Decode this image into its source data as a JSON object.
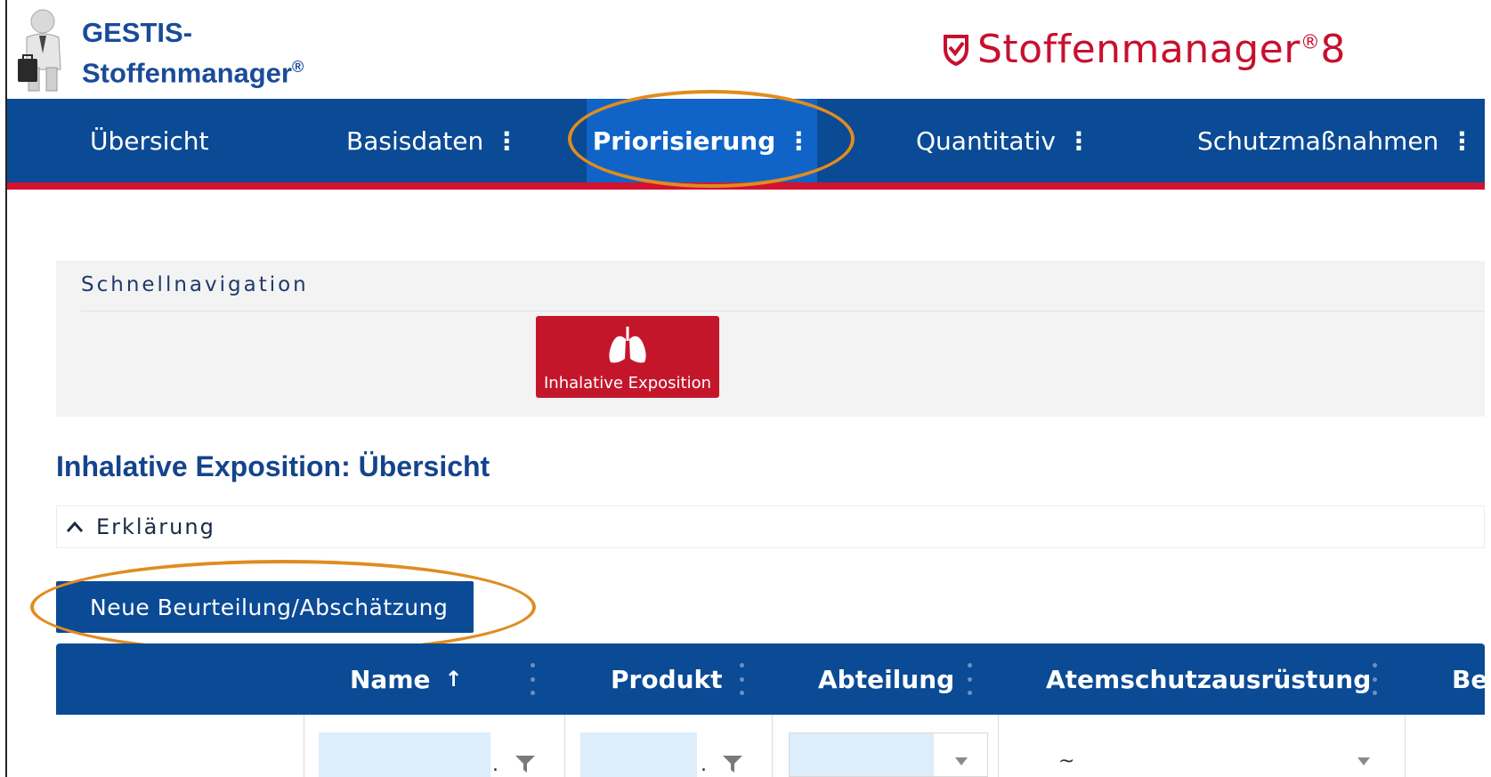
{
  "header": {
    "gestis_line1": "GESTIS-",
    "gestis_line2": "Stoffenmanager",
    "gestis_reg": "®",
    "brand_name": "Stoffenmanager",
    "brand_reg": "®",
    "brand_version": "8"
  },
  "nav": {
    "items": [
      {
        "label": "Übersicht",
        "has_menu": false,
        "active": false
      },
      {
        "label": "Basisdaten",
        "has_menu": true,
        "active": false
      },
      {
        "label": "Priorisierung",
        "has_menu": true,
        "active": true
      },
      {
        "label": "Quantitativ",
        "has_menu": true,
        "active": false
      },
      {
        "label": "Schutzmaßnahmen",
        "has_menu": true,
        "active": false
      }
    ],
    "menu_glyph": "⋮"
  },
  "quicknav": {
    "title": "Schnellnavigation",
    "tile_label": "Inhalative Exposition",
    "tile_icon": "lungs-icon"
  },
  "section": {
    "title": "Inhalative Exposition: Übersicht",
    "explain_label": "Erklärung"
  },
  "actions": {
    "new_assessment": "Neue Beurteilung/Abschätzung"
  },
  "grid": {
    "columns": [
      {
        "label": "Name",
        "sort": "↑"
      },
      {
        "label": "Produkt"
      },
      {
        "label": "Abteilung"
      },
      {
        "label": "Atemschutzausrüstung"
      },
      {
        "label": "Bet"
      }
    ],
    "filters": {
      "name_dot": ".",
      "produkt_dot": ".",
      "atemschutz_value": "~"
    }
  },
  "colors": {
    "nav_bg": "#0b4a95",
    "nav_active": "#1064c8",
    "accent_red": "#d3122f",
    "highlight_orange": "#e08c1f",
    "filter_input_bg": "#dcedfb"
  }
}
